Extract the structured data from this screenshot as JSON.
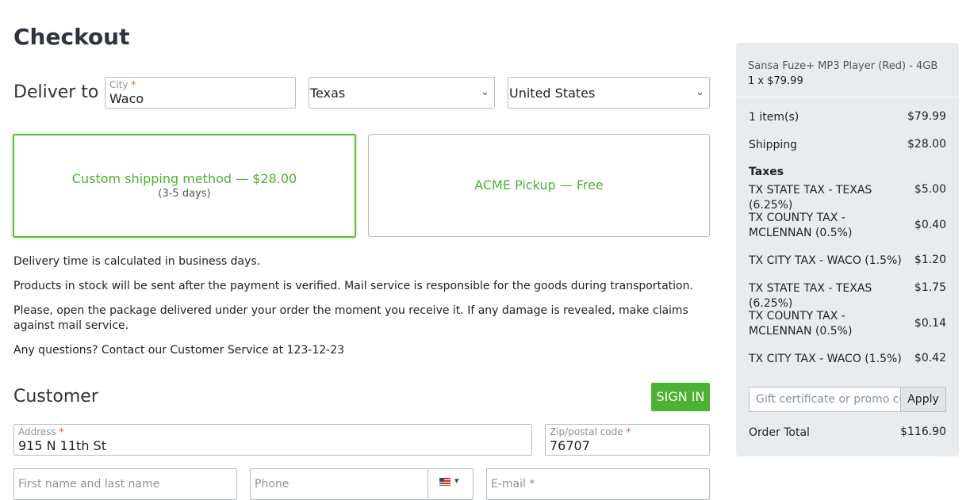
{
  "page": {
    "title": "Checkout"
  },
  "delivery": {
    "heading": "Deliver to",
    "city": {
      "label": "City",
      "required": "*",
      "value": "Waco"
    },
    "state": {
      "value": "Texas"
    },
    "country": {
      "value": "United States"
    }
  },
  "shipping": [
    {
      "name": "Custom shipping method — $28.00",
      "sub": "(3-5 days)",
      "selected": true
    },
    {
      "name": "ACME Pickup — Free",
      "sub": "",
      "selected": false
    }
  ],
  "info": [
    "Delivery time is calculated in business days.",
    "Products in stock will be sent after the payment is verified. Mail service is responsible for the goods during transportation.",
    "Please, open the package delivered under your order the moment you receive it. If any damage is revealed, make claims against mail service.",
    "Any questions? Contact our Customer Service at 123-12-23"
  ],
  "customer": {
    "heading": "Customer",
    "signin_label": "SIGN IN",
    "address": {
      "label": "Address",
      "required": "*",
      "value": "915 N 11th St"
    },
    "zip": {
      "label": "Zip/postal code",
      "required": "*",
      "value": "76707"
    },
    "name_placeholder": "First name and last name",
    "phone_placeholder": "Phone",
    "email": {
      "label": "E-mail",
      "required": "*"
    }
  },
  "summary": {
    "product": "Sansa Fuze+ MP3 Player (Red) - 4GB",
    "qty_price": "1 x $79.99",
    "items": {
      "label": "1 item(s)",
      "value": "$79.99"
    },
    "shipping": {
      "label": "Shipping",
      "value": "$28.00"
    },
    "taxes_heading": "Taxes",
    "taxes": [
      {
        "label": "TX STATE TAX - TEXAS (6.25%)",
        "value": "$5.00"
      },
      {
        "label": "TX COUNTY TAX - MCLENNAN (0.5%)",
        "value": "$0.40"
      },
      {
        "label": "TX CITY TAX - WACO (1.5%)",
        "value": "$1.20"
      },
      {
        "label": "TX STATE TAX - TEXAS (6.25%)",
        "value": "$1.75"
      },
      {
        "label": "TX COUNTY TAX - MCLENNAN (0.5%)",
        "value": "$0.14"
      },
      {
        "label": "TX CITY TAX - WACO (1.5%)",
        "value": "$0.42"
      }
    ],
    "promo_placeholder": "Gift certificate or promo code",
    "apply_label": "Apply",
    "total": {
      "label": "Order Total",
      "value": "$116.90"
    }
  },
  "icons": {
    "select_chevron": "chevron-down-icon",
    "flag": "us-flag-icon"
  },
  "colors": {
    "accent": "#4db133",
    "required": "#e0592c",
    "sidebar_bg": "#e8ecef"
  }
}
